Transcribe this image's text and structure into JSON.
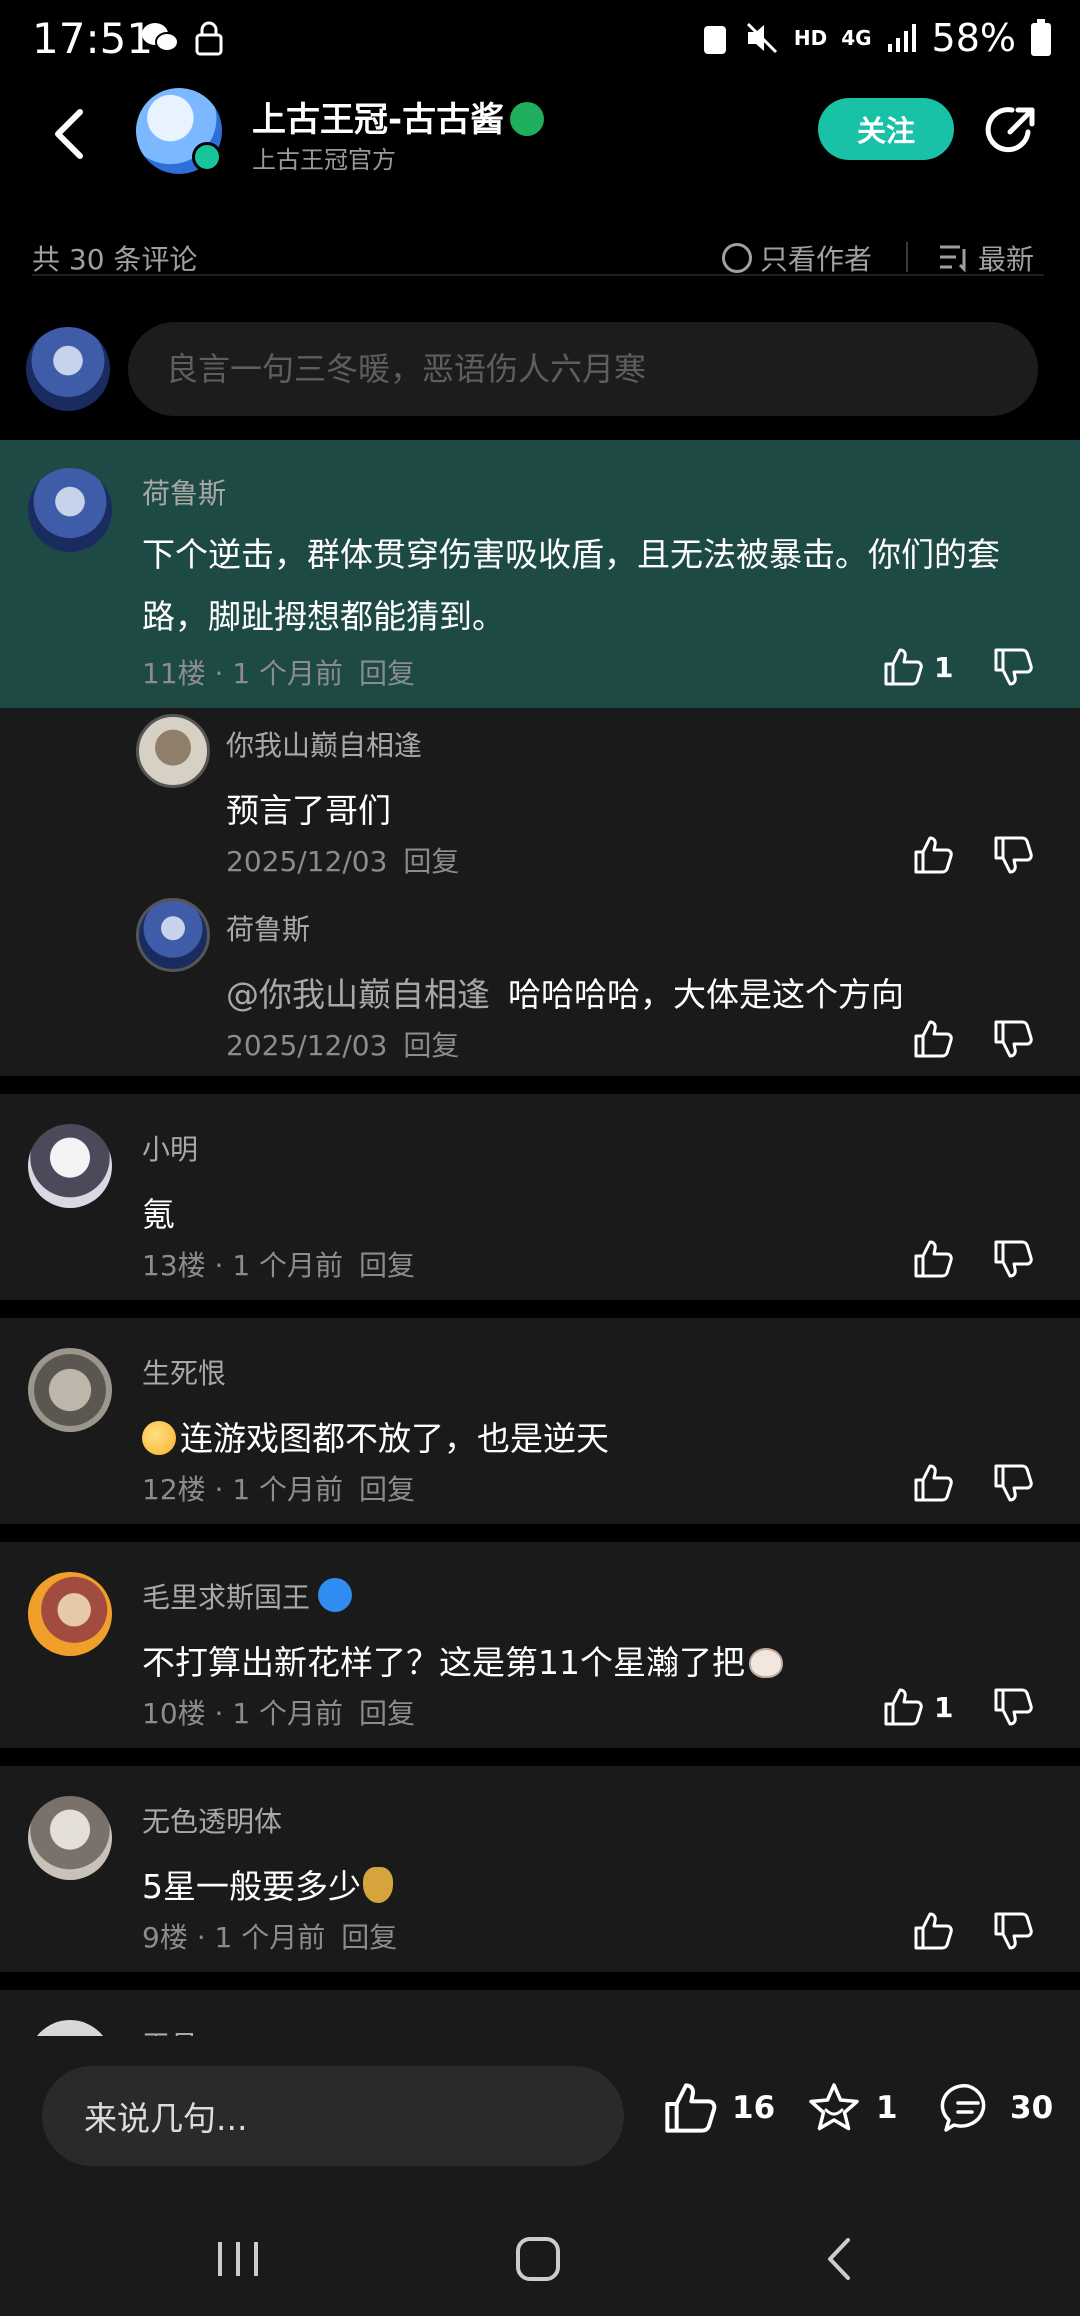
{
  "status_bar": {
    "time": "17:51",
    "battery": "58%",
    "hd_label": "HD",
    "network_label": "4G"
  },
  "header": {
    "title": "上古王冠-古古酱",
    "subtitle": "上古王冠官方",
    "follow_label": "关注"
  },
  "meta": {
    "comment_count": "共 30 条评论",
    "only_author_label": "只看作者",
    "sort_label": "最新"
  },
  "comment_input": {
    "placeholder": "良言一句三冬暖，恶语伤人六月寒"
  },
  "comments": [
    {
      "user": "荷鲁斯",
      "text": "下个逆击，群体贯穿伤害吸收盾，且无法被暴击。你们的套路，脚趾拇想都能猜到。",
      "meta": "11楼 · 1 个月前",
      "reply_label": "回复",
      "likes": "1",
      "replies": [
        {
          "user": "你我山巅自相逢",
          "text": "预言了哥们",
          "meta": "2025/12/03",
          "reply_label": "回复"
        },
        {
          "user": "荷鲁斯",
          "mention": "@你我山巅自相逢",
          "text": "哈哈哈哈，大体是这个方向",
          "meta": "2025/12/03",
          "reply_label": "回复"
        }
      ]
    },
    {
      "user": "小明",
      "text": "氪",
      "meta": "13楼 · 1 个月前",
      "reply_label": "回复",
      "likes": ""
    },
    {
      "user": "生死恨",
      "text": "连游戏图都不放了，也是逆天",
      "meta": "12楼 · 1 个月前",
      "reply_label": "回复",
      "likes": ""
    },
    {
      "user": "毛里求斯国王",
      "text": "不打算出新花样了？这是第11个星瀚了把",
      "meta": "10楼 · 1 个月前",
      "reply_label": "回复",
      "likes": "1"
    },
    {
      "user": "无色透明体",
      "text": "5星一般要多少",
      "meta": "9楼 · 1 个月前",
      "reply_label": "回复",
      "likes": ""
    }
  ],
  "partial_comment": {
    "user": "王月"
  },
  "bottom_bar": {
    "say_placeholder": "来说几句...",
    "likes": "16",
    "favorites": "1",
    "comments": "30"
  },
  "colors": {
    "accent": "#19c1a6",
    "highlight_bg": "#1e4a45",
    "card_bg": "#1a1a1a"
  },
  "icons": [
    "back-arrow-icon",
    "share-icon",
    "thumb-up-icon",
    "thumb-down-icon",
    "star-icon",
    "comment-bubble-icon",
    "sort-icon",
    "recent-apps-icon",
    "home-icon",
    "nav-back-icon"
  ]
}
